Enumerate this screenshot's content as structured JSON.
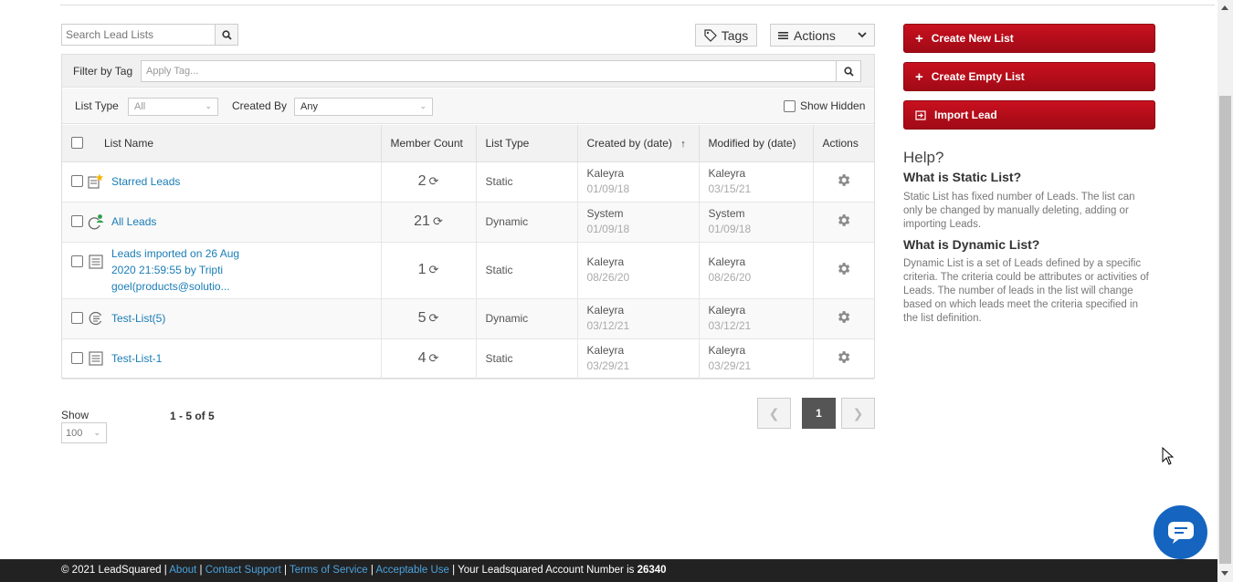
{
  "toolbar": {
    "search_placeholder": "Search Lead Lists",
    "tags_label": "Tags",
    "actions_label": "Actions"
  },
  "filters": {
    "filter_by_tag_label": "Filter by Tag",
    "apply_tag_placeholder": "Apply Tag...",
    "list_type_label": "List Type",
    "list_type_value": "All",
    "created_by_label": "Created By",
    "created_by_value": "Any",
    "show_hidden_label": "Show Hidden"
  },
  "table": {
    "columns": [
      "List Name",
      "Member Count",
      "List Type",
      "Created by (date)",
      "Modified by (date)",
      "Actions"
    ],
    "rows": [
      {
        "name": "Starred Leads",
        "count": "2",
        "type": "Static",
        "created_by": "Kaleyra",
        "created_on": "01/09/18",
        "modified_by": "Kaleyra",
        "modified_on": "03/15/21",
        "icon": "starred-list-icon"
      },
      {
        "name": "All Leads",
        "count": "21",
        "type": "Dynamic",
        "created_by": "System",
        "created_on": "01/09/18",
        "modified_by": "System",
        "modified_on": "01/09/18",
        "icon": "all-leads-icon"
      },
      {
        "name_lines": [
          "Leads imported on 26 Aug",
          "2020 21:59:55 by Tripti",
          "goel(products@solutio..."
        ],
        "count": "1",
        "type": "Static",
        "created_by": "Kaleyra",
        "created_on": "08/26/20",
        "modified_by": "Kaleyra",
        "modified_on": "08/26/20",
        "icon": "static-list-icon"
      },
      {
        "name": "Test-List(5)",
        "count": "5",
        "type": "Dynamic",
        "created_by": "Kaleyra",
        "created_on": "03/12/21",
        "modified_by": "Kaleyra",
        "modified_on": "03/12/21",
        "icon": "dynamic-list-icon"
      },
      {
        "name": "Test-List-1",
        "count": "4",
        "type": "Static",
        "created_by": "Kaleyra",
        "created_on": "03/29/21",
        "modified_by": "Kaleyra",
        "modified_on": "03/29/21",
        "icon": "static-list-icon"
      }
    ]
  },
  "pagination": {
    "show_label": "Show",
    "page_size": "100",
    "range_text": "1 - 5 of 5",
    "current_page": "1"
  },
  "sidebar": {
    "create_new_list": "Create New List",
    "create_empty_list": "Create Empty List",
    "import_lead": "Import Lead",
    "help_title": "Help?",
    "static_q": "What is Static List?",
    "static_a": "Static List has fixed number of Leads. The list can only be changed by manually deleting, adding or importing Leads.",
    "dynamic_q": "What is Dynamic List?",
    "dynamic_a": "Dynamic List is a set of Leads defined by a specific criteria. The criteria could be attributes or activities of Leads. The number of leads in the list will change based on which leads meet the criteria specified in the list definition."
  },
  "footer": {
    "copyright": "© 2021 LeadSquared",
    "sep": " | ",
    "about": "About",
    "contact_support": "Contact Support",
    "terms": "Terms of Service",
    "acceptable_use": "Acceptable Use",
    "account_text": "Your Leadsquared Account Number is ",
    "account_number": "26340"
  },
  "colors": {
    "accent_red": "#b40c1a",
    "link_blue": "#1a7db5",
    "footer_bg": "#222222",
    "chat_blue": "#1565c0"
  }
}
